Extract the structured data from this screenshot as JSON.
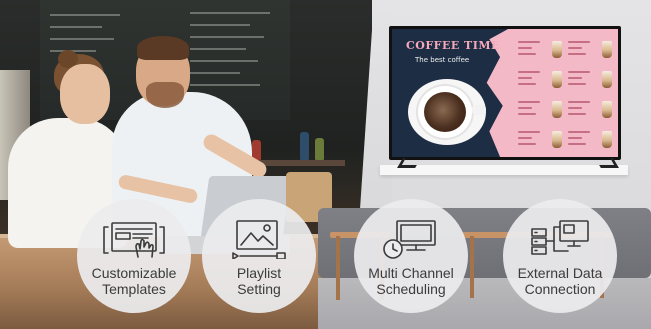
{
  "tv_screen": {
    "title": "COFFEE TIME",
    "subtitle": "The best coffee"
  },
  "features": [
    {
      "line1": "Customizable",
      "line2": "Templates",
      "icon": "template-hand-icon"
    },
    {
      "line1": "Playlist",
      "line2": "Setting",
      "icon": "playlist-image-icon"
    },
    {
      "line1": "Multi Channel",
      "line2": "Scheduling",
      "icon": "clock-monitor-icon"
    },
    {
      "line1": "External Data",
      "line2": "Connection",
      "icon": "server-network-icon"
    }
  ],
  "colors": {
    "circle_bg": "#ececee",
    "label_text": "#3b3b3b",
    "tv_title_pink": "#f6a9bb",
    "tv_panel_pink": "#f4b9c6",
    "tv_navy": "#1d2d44"
  }
}
